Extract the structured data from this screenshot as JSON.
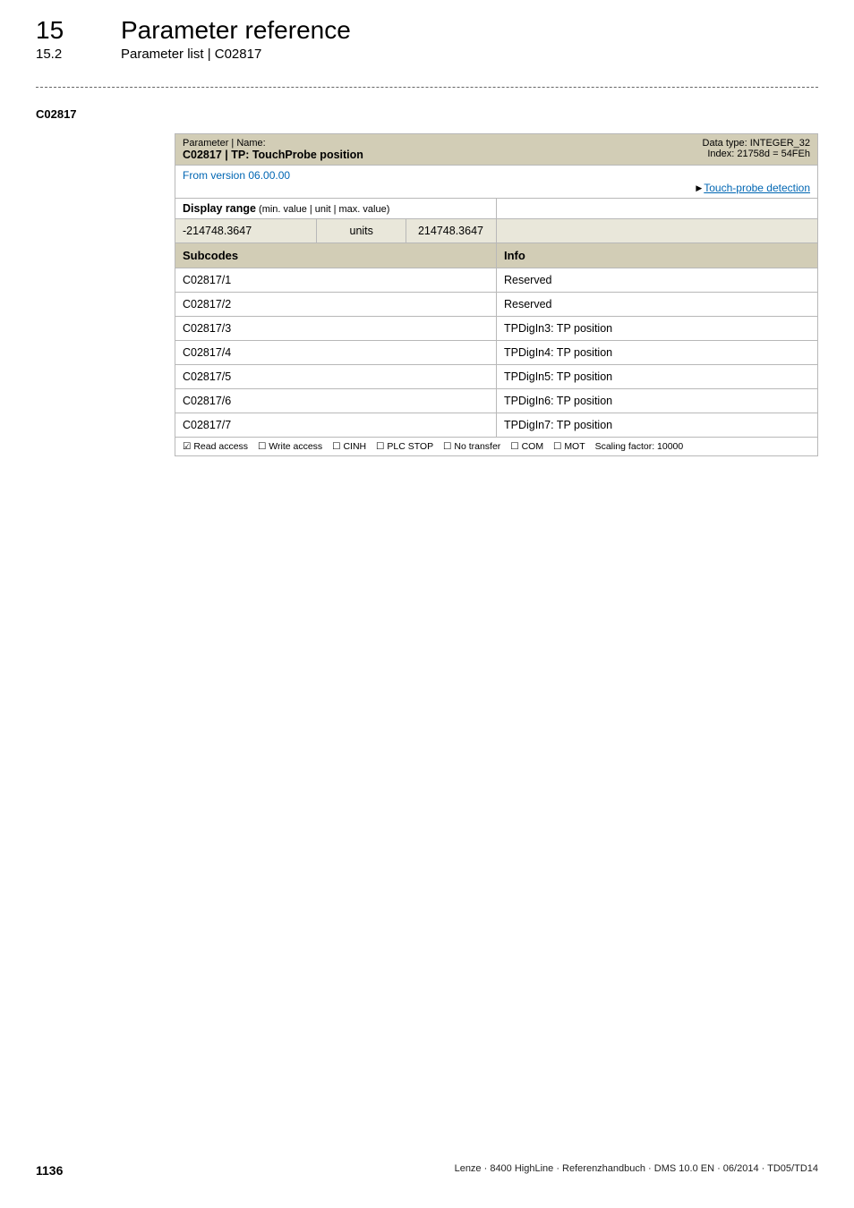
{
  "header": {
    "chapter_num": "15",
    "chapter_title": "Parameter reference",
    "sub_num": "15.2",
    "sub_title": "Parameter list | C02817"
  },
  "section_code": "C02817",
  "param_header": {
    "label": "Parameter | Name:",
    "name": "C02817 | TP: TouchProbe position",
    "dtype": "Data type: INTEGER_32",
    "index": "Index: 21758d = 54FEh"
  },
  "version_text": "From version 06.00.00",
  "link_text": "Touch-probe detection",
  "display_range": {
    "label": "Display range",
    "sublabel": " (min. value | unit | max. value)",
    "min": "-214748.3647",
    "unit": "units",
    "max": "214748.3647"
  },
  "subcodes_header": {
    "left": "Subcodes",
    "right": "Info"
  },
  "rows": [
    {
      "code": "C02817/1",
      "info": "Reserved"
    },
    {
      "code": "C02817/2",
      "info": "Reserved"
    },
    {
      "code": "C02817/3",
      "info": "TPDigIn3: TP position"
    },
    {
      "code": "C02817/4",
      "info": "TPDigIn4: TP position"
    },
    {
      "code": "C02817/5",
      "info": "TPDigIn5: TP position"
    },
    {
      "code": "C02817/6",
      "info": "TPDigIn6: TP position"
    },
    {
      "code": "C02817/7",
      "info": "TPDigIn7: TP position"
    }
  ],
  "access_footer": {
    "read": "☑ Read access",
    "write": "☐ Write access",
    "cinh": "☐ CINH",
    "plc": "☐ PLC STOP",
    "notrans": "☐ No transfer",
    "com": "☐ COM",
    "mot": "☐ MOT",
    "scaling": "Scaling factor: 10000"
  },
  "footer": {
    "page": "1136",
    "text": "Lenze · 8400 HighLine · Referenzhandbuch · DMS 10.0 EN · 06/2014 · TD05/TD14"
  }
}
